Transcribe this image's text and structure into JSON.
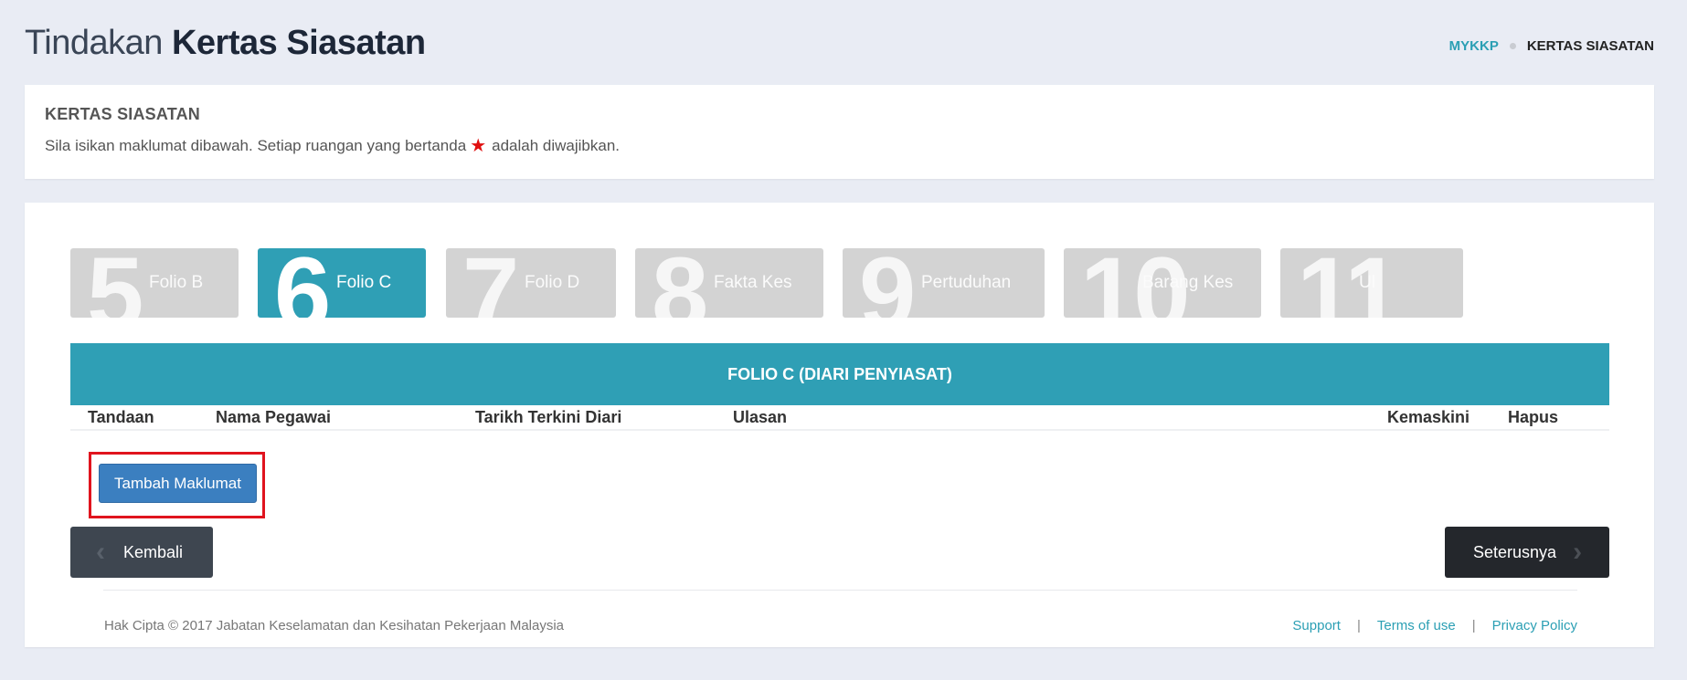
{
  "page": {
    "title_light": "Tindakan",
    "title_bold": "Kertas Siasatan"
  },
  "breadcrumb": {
    "root": "MYKKP",
    "current": "KERTAS SIASATAN"
  },
  "info": {
    "title": "KERTAS SIASATAN",
    "text_before": "Sila isikan maklumat dibawah. Setiap ruangan yang bertanda",
    "required_icon": "star-icon",
    "required_color": "#e01010",
    "text_after": "adalah diwajibkan."
  },
  "steps": [
    {
      "number": "5",
      "label": "Folio B",
      "active": false
    },
    {
      "number": "6",
      "label": "Folio C",
      "active": true
    },
    {
      "number": "7",
      "label": "Folio D",
      "active": false
    },
    {
      "number": "8",
      "label": "Fakta Kes",
      "active": false
    },
    {
      "number": "9",
      "label": "Pertuduhan",
      "active": false
    },
    {
      "number": "10",
      "label": "Barang Kes",
      "active": false
    },
    {
      "number": "11",
      "label": "Ul",
      "active": false
    }
  ],
  "table": {
    "title": "FOLIO C (DIARI PENYIASAT)",
    "columns": [
      "Tandaan",
      "Nama Pegawai",
      "Tarikh Terkini Diari",
      "Ulasan",
      "Kemaskini",
      "Hapus"
    ],
    "rows": []
  },
  "buttons": {
    "add": "Tambah Maklumat",
    "back": "Kembali",
    "next": "Seterusnya"
  },
  "footer": {
    "copyright": "Hak Cipta © 2017 Jabatan Keselamatan dan Kesihatan Pekerjaan Malaysia",
    "links": [
      "Support",
      "Terms of use",
      "Privacy Policy"
    ],
    "separator": "|"
  },
  "colors": {
    "accent": "#2f9fb5",
    "step_inactive": "#d3d3d3",
    "add_button": "#3b7fc0",
    "highlight": "#e0141e"
  }
}
